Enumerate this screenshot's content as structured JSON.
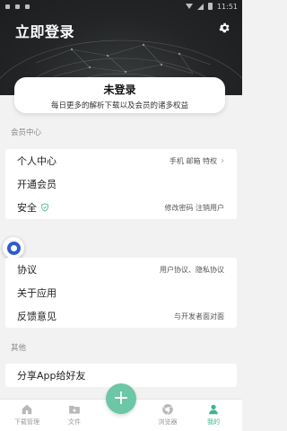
{
  "status_bar": {
    "time": "11:51"
  },
  "header": {
    "title": "立即登录",
    "settings_icon": "gear-icon"
  },
  "login_card": {
    "title": "未登录",
    "subtitle": "每日更多的解析下载以及会员的诸多权益"
  },
  "sections": {
    "member_center": "会员中心",
    "other": "其他"
  },
  "member_rows": [
    {
      "label": "个人中心",
      "value": "手机 邮箱 特权"
    },
    {
      "label": "开通会员",
      "value": ""
    },
    {
      "label": "安全",
      "value": "修改密码  注销用户"
    }
  ],
  "info_rows": [
    {
      "label": "协议",
      "value": "用户协议、隐私协议"
    },
    {
      "label": "关于应用",
      "value": ""
    },
    {
      "label": "反馈意见",
      "value": "与开发者面对面"
    }
  ],
  "other_rows": [
    {
      "label": "分享App给好友"
    }
  ],
  "tabs": [
    {
      "label": "下载管理",
      "icon": "home-icon"
    },
    {
      "label": "文件",
      "icon": "folder-icon"
    },
    {
      "label": "浏览器",
      "icon": "browser-icon"
    },
    {
      "label": "我的",
      "icon": "person-icon"
    }
  ],
  "fab_label": "+",
  "colors": {
    "accent": "#3fb58a",
    "fab": "#6bc7a5",
    "header_bg": "#232526",
    "float_btn": "#2f5bd3"
  }
}
